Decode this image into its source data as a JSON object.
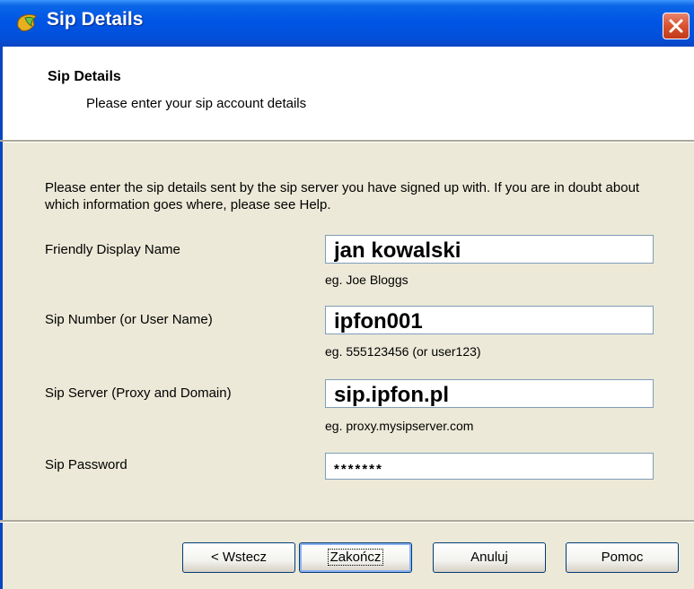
{
  "window": {
    "title": "Sip Details",
    "close_icon": "close-icon",
    "app_icon": "app-icon"
  },
  "header": {
    "title": "Sip Details",
    "subtitle": "Please enter your sip account details"
  },
  "intro": "Please enter the sip details sent by the sip server you have signed up with. If you are in doubt about which information goes where, please see Help.",
  "fields": {
    "display_name": {
      "label": "Friendly Display Name",
      "value": "jan kowalski",
      "hint": "eg.  Joe Bloggs"
    },
    "sip_number": {
      "label": "Sip Number (or User Name)",
      "value": "ipfon001",
      "hint": "eg.  555123456  (or user123)"
    },
    "sip_server": {
      "label": "Sip Server (Proxy and Domain)",
      "value": "sip.ipfon.pl",
      "hint": "eg.  proxy.mysipserver.com"
    },
    "sip_password": {
      "label": "Sip Password",
      "value": "*******"
    }
  },
  "buttons": {
    "back": "< Wstecz",
    "finish": "Zakończ",
    "cancel": "Anuluj",
    "help": "Pomoc"
  },
  "colors": {
    "titlebar": "#0055E5",
    "dialog_bg": "#ECE9D8",
    "close": "#D9532F"
  }
}
